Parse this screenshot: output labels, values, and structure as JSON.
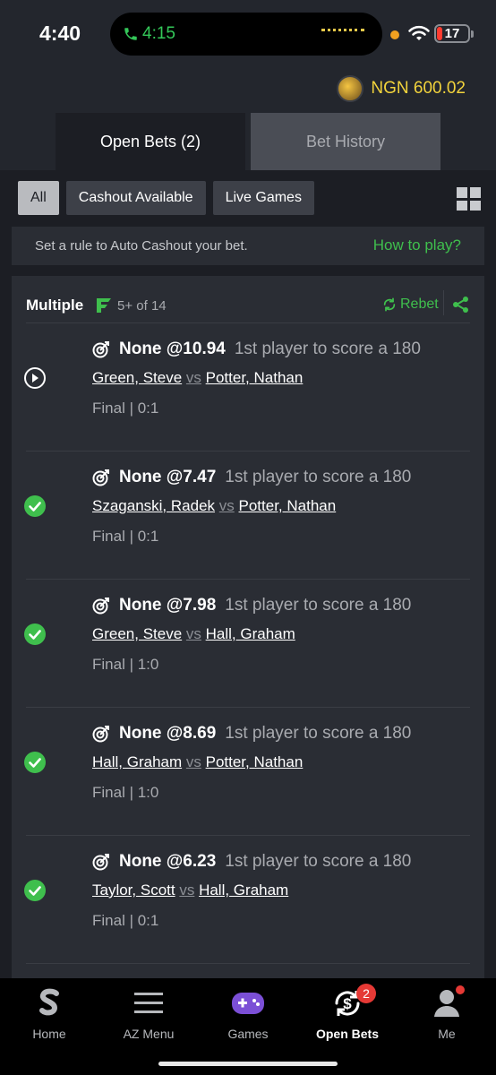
{
  "status_bar": {
    "time": "4:40",
    "call_time": "4:15",
    "battery": "17"
  },
  "balance": {
    "amount": "NGN 600.02"
  },
  "tabs": [
    {
      "label": "Open Bets (2)"
    },
    {
      "label": "Bet History"
    }
  ],
  "filters": [
    {
      "label": "All"
    },
    {
      "label": "Cashout Available"
    },
    {
      "label": "Live Games"
    }
  ],
  "auto_cashout": {
    "text": "Set a rule to Auto Cashout your bet.",
    "link": "How to play?"
  },
  "bet": {
    "title": "Multiple",
    "count": "5+ of 14",
    "rebet": "Rebet",
    "legs": [
      {
        "status": "live",
        "selection": "None @10.94",
        "market": "1st player to score a 180",
        "home": "Green, Steve",
        "vs": "vs",
        "away": "Potter, Nathan",
        "result": "Final | 0:1"
      },
      {
        "status": "won",
        "selection": "None @7.47",
        "market": "1st player to score a 180",
        "home": "Szaganski, Radek",
        "vs": "vs",
        "away": "Potter, Nathan",
        "result": "Final | 0:1"
      },
      {
        "status": "won",
        "selection": "None @7.98",
        "market": "1st player to score a 180",
        "home": "Green, Steve",
        "vs": "vs",
        "away": "Hall, Graham",
        "result": "Final | 1:0"
      },
      {
        "status": "won",
        "selection": "None @8.69",
        "market": "1st player to score a 180",
        "home": "Hall, Graham",
        "vs": "vs",
        "away": "Potter, Nathan",
        "result": "Final | 1:0"
      },
      {
        "status": "won",
        "selection": "None @6.23",
        "market": "1st player to score a 180",
        "home": "Taylor, Scott",
        "vs": "vs",
        "away": "Hall, Graham",
        "result": "Final | 0:1"
      }
    ]
  },
  "bottom_nav": [
    {
      "label": "Home"
    },
    {
      "label": "AZ Menu"
    },
    {
      "label": "Games"
    },
    {
      "label": "Open Bets",
      "badge": "2"
    },
    {
      "label": "Me"
    }
  ],
  "colors": {
    "accent": "#3fbf4d",
    "balance": "#f2d33c",
    "badge": "#e53935"
  }
}
